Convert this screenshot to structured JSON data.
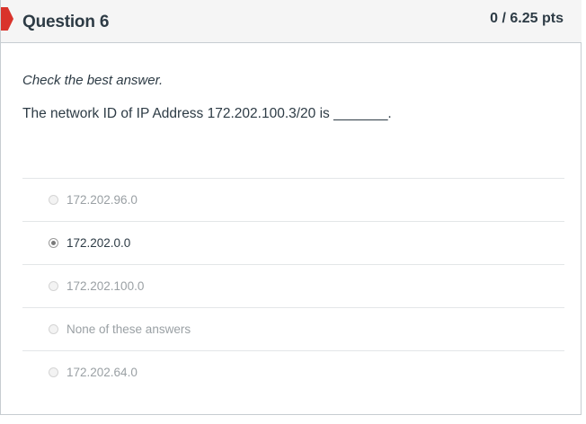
{
  "question": {
    "title": "Question 6",
    "points": "0 / 6.25 pts",
    "instructions": "Check the best answer.",
    "text": "The network ID of IP Address 172.202.100.3/20 is _______.",
    "flag_color": "#d9332b"
  },
  "answers": [
    {
      "label": "172.202.96.0",
      "selected": false
    },
    {
      "label": "172.202.0.0",
      "selected": true
    },
    {
      "label": "172.202.100.0",
      "selected": false
    },
    {
      "label": "None of these answers",
      "selected": false
    },
    {
      "label": "172.202.64.0",
      "selected": false
    }
  ]
}
